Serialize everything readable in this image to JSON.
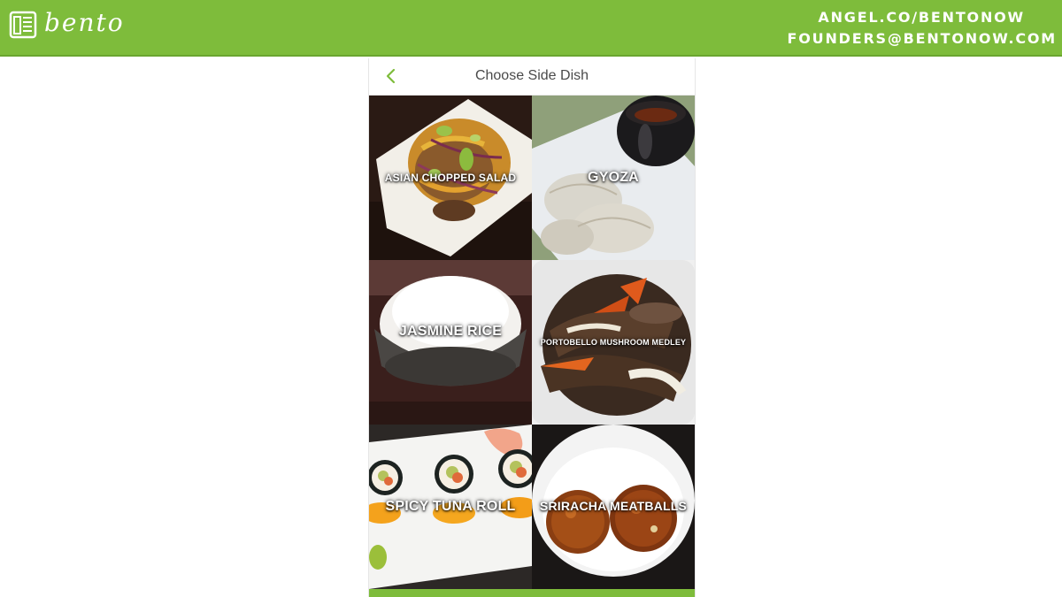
{
  "banner": {
    "brand_name": "bento",
    "brand_icon": "bento-box-icon",
    "contact_line1": "ANGEL.CO/BENTONOW",
    "contact_line2": "FOUNDERS@BENTONOW.COM",
    "color": "#7ebc3b"
  },
  "screen": {
    "title": "Choose Side Dish",
    "back_icon": "chevron-left-icon",
    "accent_color": "#7ebc3b",
    "dishes": [
      {
        "name": "ASIAN CHOPPED SALAD"
      },
      {
        "name": "GYOZA"
      },
      {
        "name": "JASMINE RICE"
      },
      {
        "name": "PORTOBELLO MUSHROOM MEDLEY"
      },
      {
        "name": "SPICY TUNA ROLL"
      },
      {
        "name": "SRIRACHA MEATBALLS"
      }
    ]
  }
}
